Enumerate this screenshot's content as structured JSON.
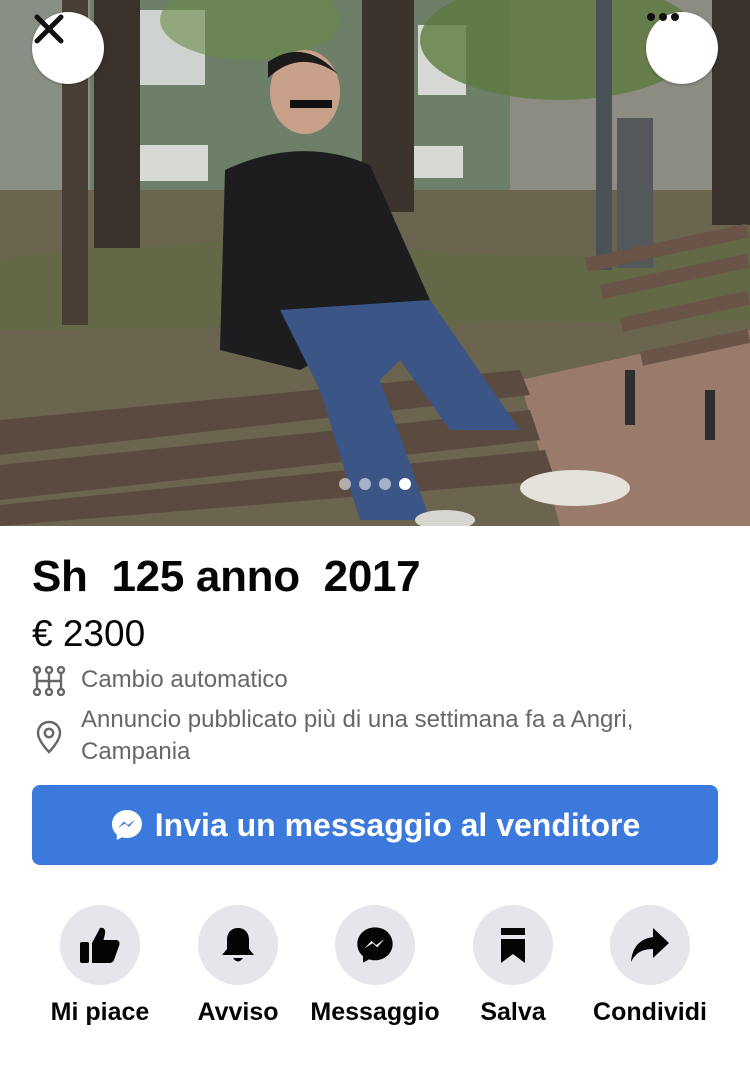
{
  "listing": {
    "title": "Sh  125 anno  2017",
    "price": "€ 2300",
    "transmission": "Cambio automatico",
    "location_text": "Annuncio pubblicato più di una settimana fa a Angri, Campania"
  },
  "photo": {
    "total_images": 4,
    "active_index": 3,
    "description_icon": "photo"
  },
  "top_bar": {
    "close_icon": "close-icon",
    "more_icon": "more-dots-icon"
  },
  "cta": {
    "label": "Invia un messaggio al venditore",
    "icon": "messenger-icon"
  },
  "actions": [
    {
      "label": "Mi piace",
      "icon": "thumbs-up-icon"
    },
    {
      "label": "Avviso",
      "icon": "bell-icon"
    },
    {
      "label": "Messaggio",
      "icon": "messenger-icon"
    },
    {
      "label": "Salva",
      "icon": "bookmark-icon"
    },
    {
      "label": "Condividi",
      "icon": "share-icon"
    }
  ],
  "colors": {
    "accent": "#3b79dc",
    "text": "#050505",
    "secondary_text": "#65676b",
    "action_circle": "#e4e6eb"
  }
}
